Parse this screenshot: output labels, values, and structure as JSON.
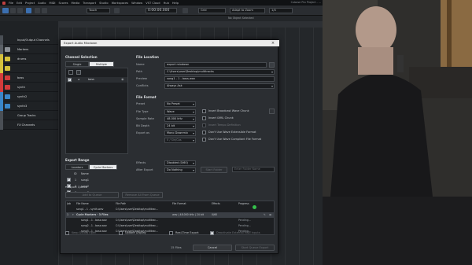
{
  "menu": [
    "File",
    "Edit",
    "Project",
    "Audio",
    "MIDI",
    "Scores",
    "Media",
    "Transport",
    "Studio",
    "Workspaces",
    "Window",
    "VST Cloud",
    "Hub",
    "Help"
  ],
  "window_title": "Cubase Pro Project - ...",
  "toolbar": {
    "touch_mode": "Touch",
    "time_display": "0:00:00.000",
    "grid_label": "Grid",
    "snap_mode": "Adapt to Zoom",
    "quantize": "1/4"
  },
  "status": {
    "no_object": "No Object Selected"
  },
  "tracks": [
    {
      "label": "Input/Output Channels",
      "color": "#4a4f55"
    },
    {
      "label": "Markers",
      "color": "#5b6066"
    },
    {
      "label": "drums",
      "color": "#d6c23c"
    },
    {
      "label": "",
      "color": "#d6c23c"
    },
    {
      "label": "bass",
      "color": "#d23b3b"
    },
    {
      "label": "synth",
      "color": "#d23b3b"
    },
    {
      "label": "synth2",
      "color": "#3a86c8"
    },
    {
      "label": "synth3",
      "color": "#3a86c8"
    },
    {
      "label": "Group Tracks",
      "color": "#4a4f55"
    },
    {
      "label": "FX Channels",
      "color": "#4a4f55"
    }
  ],
  "dialog": {
    "title": "Export Audio Mixdown",
    "close": "×",
    "channel_selection": {
      "heading": "Channel Selection",
      "mode_single": "Single",
      "mode_multiple": "Multiple",
      "channel_item": "bass"
    },
    "file_location": {
      "heading": "File Location",
      "name_label": "Name",
      "name_value": "export mixdown",
      "path_label": "Path",
      "path_value": "C:\\Users\\user\\Desktop\\multitracks",
      "preview_label": "Preview",
      "preview_value": "song1 - 1 - bass.wav",
      "conflicts_label": "Conflicts",
      "conflicts_value": "Always Ask"
    },
    "file_format": {
      "heading": "File Format",
      "preset_label": "Preset",
      "preset_value": "No Preset",
      "filetype_label": "File Type",
      "filetype_value": "Wave",
      "samplerate_label": "Sample Rate",
      "samplerate_value": "48.000 kHz",
      "bitdepth_label": "Bit Depth",
      "bitdepth_value": "24 bit",
      "exportas_label": "Export as",
      "exportas_value": "Mono Downmix",
      "pan_value": "0 / Sin/Cos",
      "options": [
        {
          "label": "Insert Broadcast Wave Chunk",
          "checked": false,
          "dim": false
        },
        {
          "label": "Insert iXML Chunk",
          "checked": false,
          "dim": false
        },
        {
          "label": "Insert Tempo Definition",
          "checked": false,
          "dim": true
        },
        {
          "label": "Don't Use Wave Extensible Format",
          "checked": false,
          "dim": false
        },
        {
          "label": "Don't Use Wave Compliant File Format",
          "checked": false,
          "dim": false
        }
      ]
    },
    "export_range": {
      "heading": "Export Range",
      "tab_locators": "Locators",
      "tab_cycle": "Cycle Markers",
      "col_id": "ID",
      "col_name": "Name",
      "items": [
        {
          "id": "1",
          "name": "song1",
          "checked": true
        },
        {
          "id": "2",
          "name": "song2",
          "checked": true
        },
        {
          "id": "3",
          "name": "song3",
          "checked": true
        }
      ]
    },
    "effects_label": "Effects",
    "effects_value": "Disabled (0/60)",
    "after_export_label": "After Export",
    "after_export_value": "Do Nothing",
    "start_folder": "Start Folder",
    "folder_name_placeholder": "Enter Folder Name",
    "queue": {
      "heading": "Export Queue",
      "btn_add": "Add to Queue",
      "btn_remove": "Remove All From Queue",
      "columns": [
        "Job",
        "File Name",
        "File Path",
        "File Format",
        "Effects",
        "Progress"
      ],
      "rows": [
        {
          "job": "",
          "name": "song1 - 1 - synth.wav",
          "path": "C:\\Users\\user\\Desktop\\multitrac...",
          "format": "",
          "effects": "",
          "progress": ""
        },
        {
          "job": "1",
          "name": "Cycle Markers - 3 Files",
          "path": "",
          "format": "wav | 48.000 kHz | 24 bit",
          "effects": "0/60",
          "progress": "",
          "group": true
        },
        {
          "job": "",
          "name": "song1 - 1 - bass.wav",
          "path": "C:\\Users\\user\\Desktop\\multitrac...",
          "format": "",
          "effects": "",
          "progress": "Pending..."
        },
        {
          "job": "",
          "name": "song2 - 1 - bass.wav",
          "path": "C:\\Users\\user\\Desktop\\multitrac...",
          "format": "",
          "effects": "",
          "progress": "Pending..."
        },
        {
          "job": "",
          "name": "song3 - 1 - bass.wav",
          "path": "C:\\Users\\user\\Desktop\\multitrac...",
          "format": "",
          "effects": "",
          "progress": "Pending..."
        }
      ]
    },
    "opt_keep_open": "Keep Dialog Open",
    "opt_update_display": "Update Display",
    "opt_realtime": "Real-Time Export",
    "opt_deactivate_midi": "Deactivate External MIDI Inputs",
    "file_count": "15 Files",
    "btn_cancel": "Cancel",
    "btn_start": "Start Queue Export"
  }
}
